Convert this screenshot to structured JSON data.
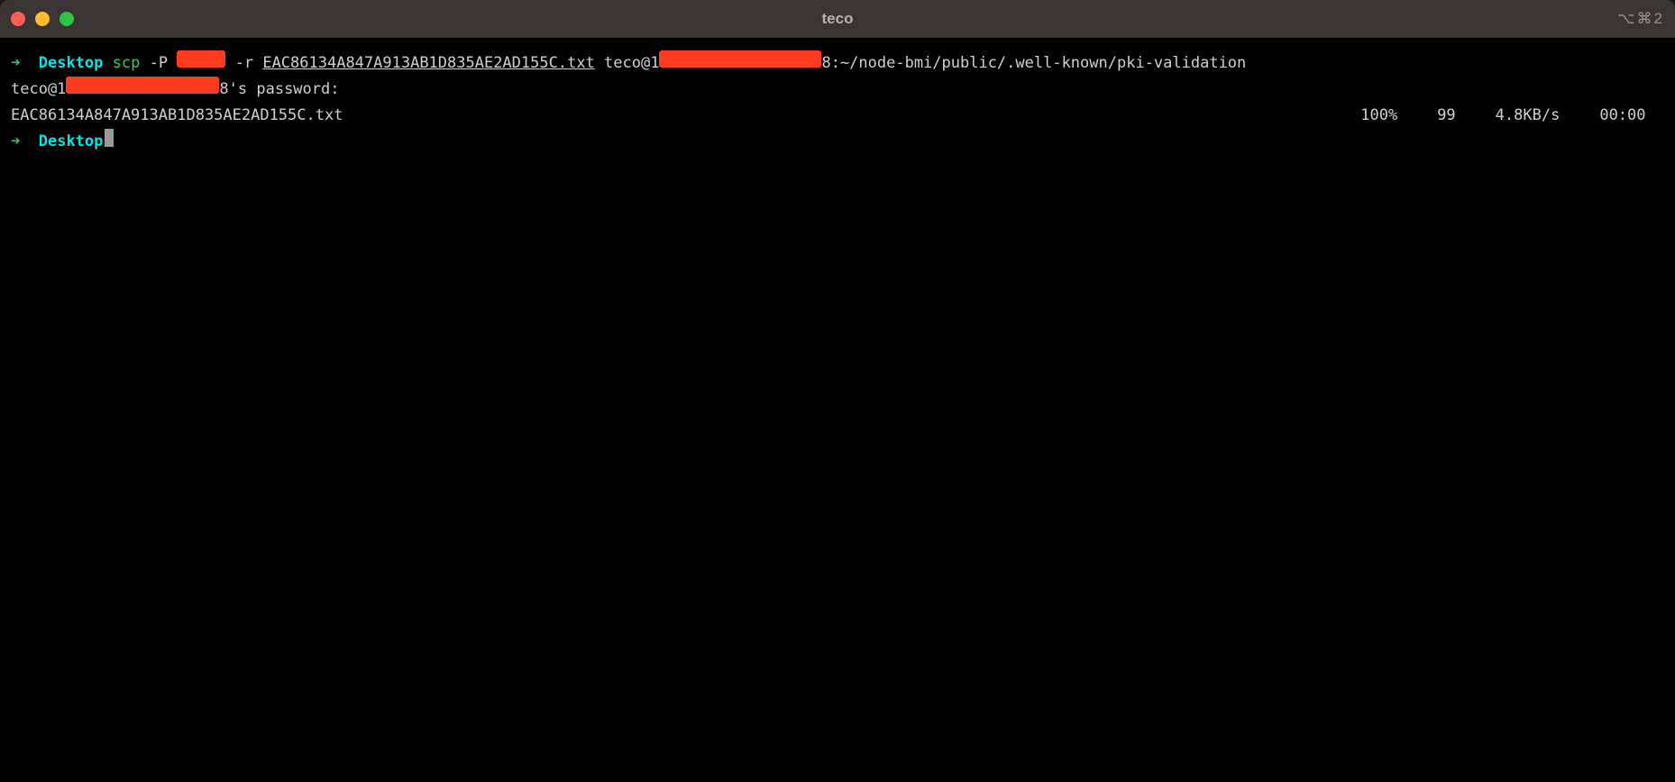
{
  "window": {
    "title": "teco",
    "shortcut_hint": "⌥⌘2"
  },
  "colors": {
    "titlebar_bg": "#3a3432",
    "terminal_bg": "#000000",
    "text": "#d0d0d0",
    "prompt_arrow": "#2ecc71",
    "cwd": "#00e5e5",
    "command": "#2ecc71",
    "redaction": "#ff3b1f"
  },
  "line1": {
    "arrow": "➜",
    "cwd": "Desktop",
    "cmd": "scp",
    "flag_p": "-P",
    "flag_r": "-r",
    "filename": "EAC86134A847A913AB1D835AE2AD155C.txt",
    "dest_prefix": "teco@1",
    "dest_suffix": "8:~/node-bmi/public/.well-known/pki-validation"
  },
  "line2": {
    "prefix": "teco@1",
    "suffix": "8's password:"
  },
  "line3": {
    "filename": "EAC86134A847A913AB1D835AE2AD155C.txt",
    "percent": "100%",
    "bytes": "99",
    "rate": "4.8KB/s",
    "eta": "00:00"
  },
  "line4": {
    "arrow": "➜",
    "cwd": "Desktop"
  }
}
